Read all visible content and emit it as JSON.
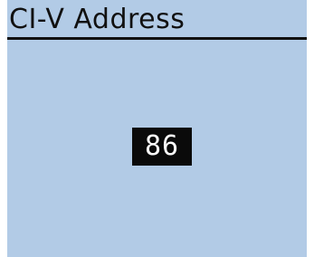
{
  "screen": {
    "title": "CI-V Address",
    "value": "86"
  },
  "colors": {
    "background": "#b2cbe6",
    "text": "#111111",
    "highlight_bg": "#0a0a0a",
    "highlight_text": "#ffffff"
  }
}
